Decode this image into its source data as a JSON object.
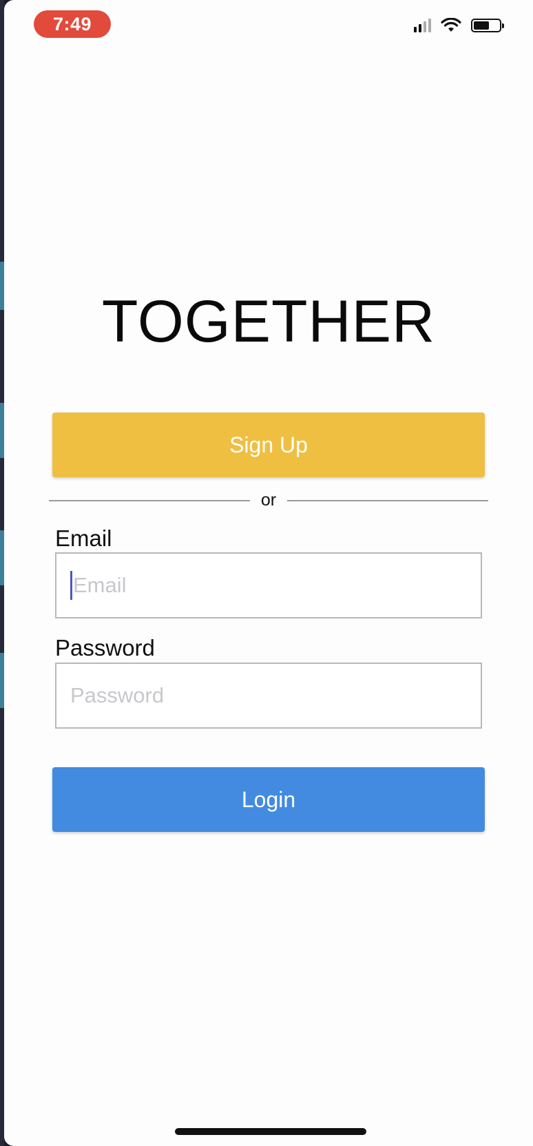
{
  "status_bar": {
    "time": "7:49",
    "icons": [
      "cellular-signal-icon",
      "wifi-icon",
      "battery-icon"
    ],
    "time_pill_color": "#e24a3b"
  },
  "app": {
    "title": "TOGETHER"
  },
  "signup_button": {
    "label": "Sign Up",
    "color": "#efbf42"
  },
  "divider": {
    "text": "or"
  },
  "form": {
    "email": {
      "label": "Email",
      "value": "",
      "placeholder": "Email"
    },
    "password": {
      "label": "Password",
      "value": "",
      "placeholder": "Password"
    }
  },
  "login_button": {
    "label": "Login",
    "color": "#428be0"
  }
}
